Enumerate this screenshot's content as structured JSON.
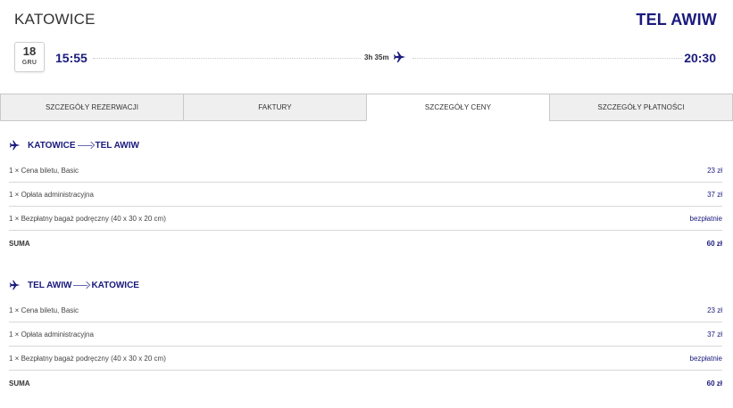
{
  "header": {
    "origin": "KATOWICE",
    "destination": "TEL AWIW",
    "date_day": "18",
    "date_month": "GRU",
    "departure_time": "15:55",
    "arrival_time": "20:30",
    "duration": "3h 35m"
  },
  "tabs": [
    {
      "label": "SZCZEGÓŁY REZERWACJI",
      "active": false
    },
    {
      "label": "FAKTURY",
      "active": false
    },
    {
      "label": "SZCZEGÓŁY CENY",
      "active": true
    },
    {
      "label": "SZCZEGÓŁY PŁATNOŚCI",
      "active": false
    }
  ],
  "colors": {
    "accent": "#1a1a7e",
    "tab_bg": "#efefef",
    "border": "#c8c8c8"
  },
  "flights": [
    {
      "from": "KATOWICE",
      "to": "TEL AWIW",
      "items": [
        {
          "label": "1 × Cena biletu, Basic",
          "amount": "23 zł"
        },
        {
          "label": "1 × Opłata administracyjna",
          "amount": "37 zł"
        },
        {
          "label": "1 × Bezpłatny bagaż podręczny (40 x 30 x 20 cm)",
          "amount": "bezpłatnie"
        }
      ],
      "total_label": "SUMA",
      "total_amount": "60 zł"
    },
    {
      "from": "TEL AWIW",
      "to": "KATOWICE",
      "items": [
        {
          "label": "1 × Cena biletu, Basic",
          "amount": "23 zł"
        },
        {
          "label": "1 × Opłata administracyjna",
          "amount": "37 zł"
        },
        {
          "label": "1 × Bezpłatny bagaż podręczny (40 x 30 x 20 cm)",
          "amount": "bezpłatnie"
        }
      ],
      "total_label": "SUMA",
      "total_amount": "60 zł"
    }
  ]
}
